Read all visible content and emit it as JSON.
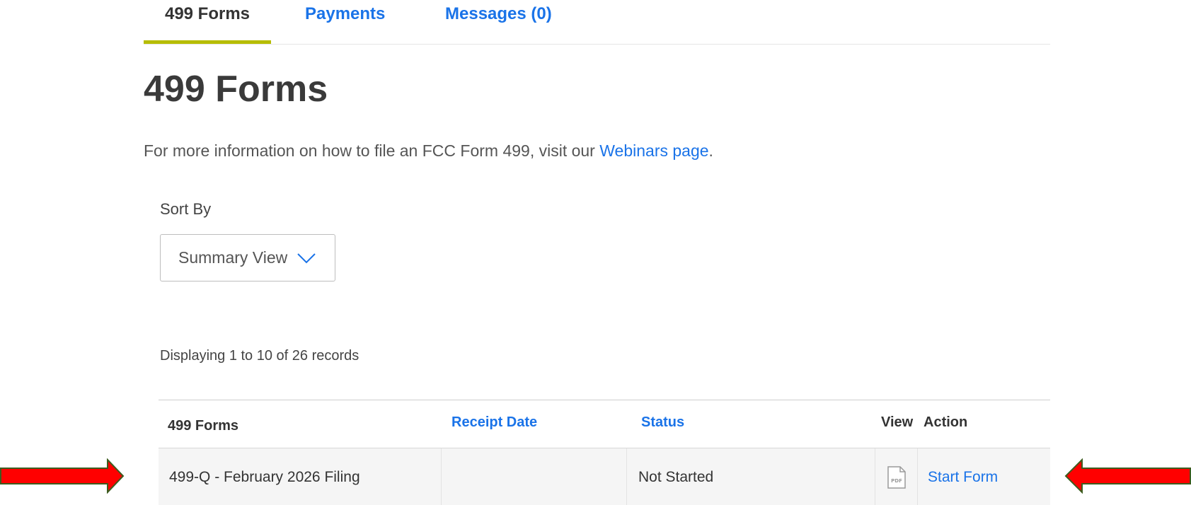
{
  "tabs": {
    "forms": "499 Forms",
    "payments": "Payments",
    "messages": "Messages (0)"
  },
  "page_title": "499 Forms",
  "info": {
    "text": "For more information on how to file an FCC Form 499, visit our ",
    "link": "Webinars page",
    "end": "."
  },
  "sort": {
    "label": "Sort By",
    "selected": "Summary View"
  },
  "records": "Displaying 1 to 10 of 26 records",
  "table": {
    "headers": {
      "form": "499 Forms",
      "receipt_date": "Receipt Date",
      "status": "Status",
      "view": "View",
      "action": "Action"
    },
    "rows": [
      {
        "form": "499-Q - February 2026 Filing",
        "receipt_date": "",
        "status": "Not Started",
        "view_icon": "pdf-icon",
        "action": "Start Form"
      }
    ]
  },
  "colors": {
    "accent": "#1a73e8",
    "tab_underline": "#b6bd00",
    "arrow_fill": "#ff0000",
    "arrow_stroke": "#3d5c1f"
  }
}
